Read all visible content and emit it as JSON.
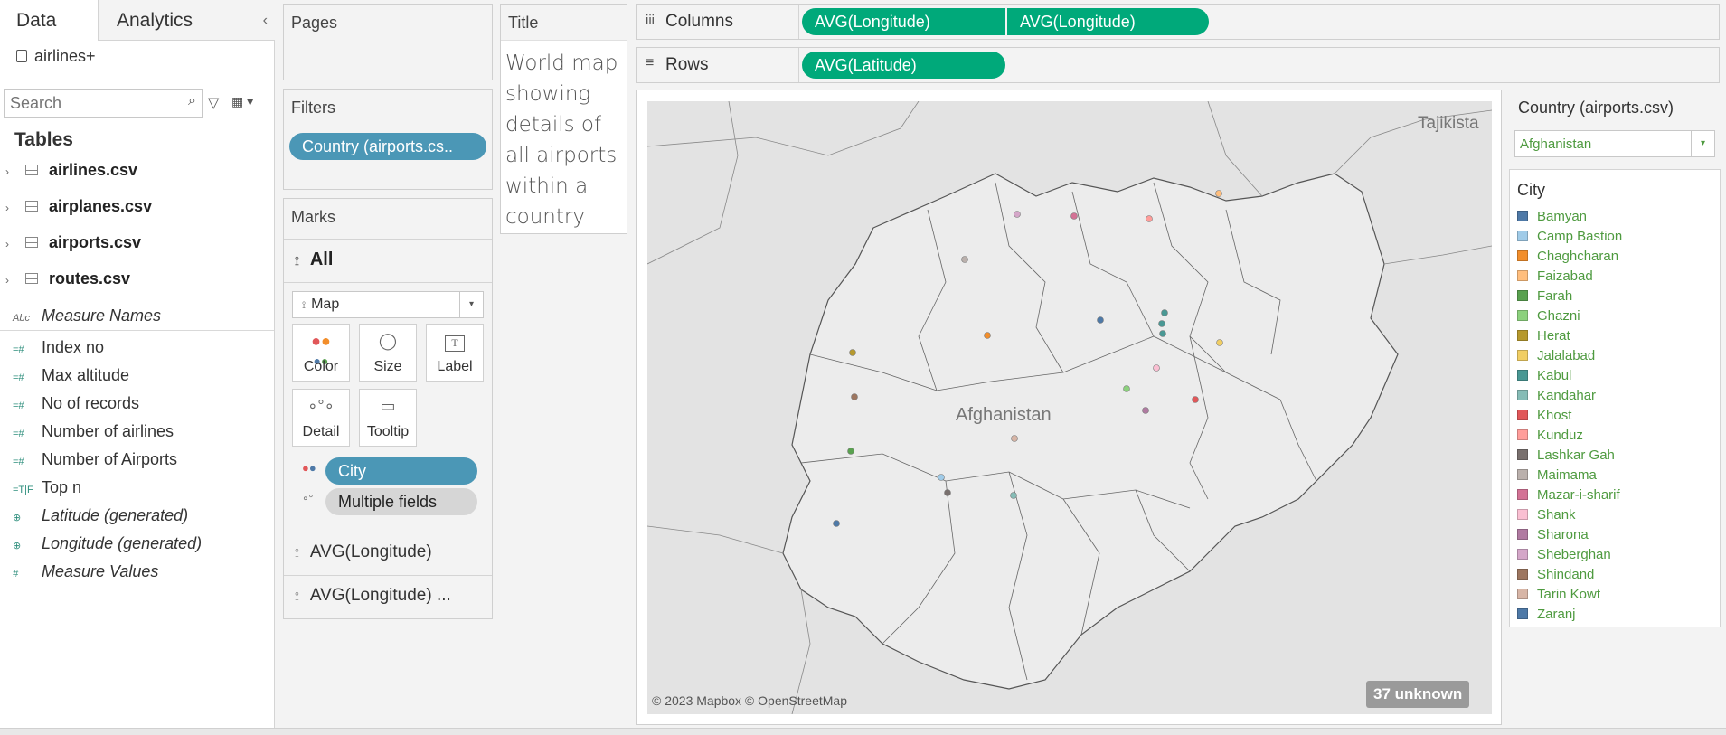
{
  "left_pane": {
    "tabs": [
      "Data",
      "Analytics"
    ],
    "datasource": "airlines+",
    "search_placeholder": "Search",
    "tables_heading": "Tables",
    "tables": [
      "airlines.csv",
      "airplanes.csv",
      "airports.csv",
      "routes.csv"
    ],
    "measure_names": "Measure Names",
    "fields": [
      {
        "name": "Index no",
        "italic": false,
        "icon": "#"
      },
      {
        "name": "Max altitude",
        "italic": false,
        "icon": "#"
      },
      {
        "name": "No of records",
        "italic": false,
        "icon": "#"
      },
      {
        "name": "Number of airlines",
        "italic": false,
        "icon": "#"
      },
      {
        "name": "Number of Airports",
        "italic": false,
        "icon": "#"
      },
      {
        "name": "Top n",
        "italic": false,
        "icon": "#"
      },
      {
        "name": "Latitude (generated)",
        "italic": true,
        "icon": "globe"
      },
      {
        "name": "Longitude (generated)",
        "italic": true,
        "icon": "globe"
      },
      {
        "name": "Measure Values",
        "italic": true,
        "icon": "#"
      }
    ]
  },
  "pages": {
    "title": "Pages"
  },
  "filters": {
    "title": "Filters",
    "pill": "Country (airports.cs.."
  },
  "marks": {
    "title": "Marks",
    "all_label": "All",
    "type": "Map",
    "cards": [
      "Color",
      "Size",
      "Label",
      "Detail",
      "Tooltip"
    ],
    "city_pill": "City",
    "fields_pill": "Multiple fields",
    "layers": [
      "AVG(Longitude)",
      "AVG(Longitude) ..."
    ]
  },
  "title_card": {
    "label": "Title",
    "text": "World map showing details of all airports within a country"
  },
  "columns": {
    "label": "Columns",
    "pills": [
      "AVG(Longitude)",
      "AVG(Longitude)"
    ]
  },
  "rows": {
    "label": "Rows",
    "pills": [
      "AVG(Latitude)"
    ]
  },
  "map": {
    "country_label": "Afghanistan",
    "neighbor_label": "Tajikista",
    "attribution": "© 2023 Mapbox © OpenStreetMap",
    "unknown_badge": "37 unknown"
  },
  "country_filter": {
    "title": "Country (airports.csv)",
    "value": "Afghanistan"
  },
  "legend": {
    "title": "City",
    "items": [
      {
        "name": "Bamyan",
        "color": "#4e79a7"
      },
      {
        "name": "Camp Bastion",
        "color": "#a0cbe8"
      },
      {
        "name": "Chaghcharan",
        "color": "#f28e2b"
      },
      {
        "name": "Faizabad",
        "color": "#ffbe7d"
      },
      {
        "name": "Farah",
        "color": "#59a14f"
      },
      {
        "name": "Ghazni",
        "color": "#8cd17d"
      },
      {
        "name": "Herat",
        "color": "#b6992d"
      },
      {
        "name": "Jalalabad",
        "color": "#f1ce63"
      },
      {
        "name": "Kabul",
        "color": "#499894"
      },
      {
        "name": "Kandahar",
        "color": "#86bcb6"
      },
      {
        "name": "Khost",
        "color": "#e15759"
      },
      {
        "name": "Kunduz",
        "color": "#ff9d9a"
      },
      {
        "name": "Lashkar Gah",
        "color": "#79706e"
      },
      {
        "name": "Maimama",
        "color": "#bab0ac"
      },
      {
        "name": "Mazar-i-sharif",
        "color": "#d37295"
      },
      {
        "name": "Shank",
        "color": "#fabfd2"
      },
      {
        "name": "Sharona",
        "color": "#b07aa1"
      },
      {
        "name": "Sheberghan",
        "color": "#d4a6c8"
      },
      {
        "name": "Shindand",
        "color": "#9d7660"
      },
      {
        "name": "Tarin Kowt",
        "color": "#d7b5a6"
      },
      {
        "name": "Zaranj",
        "color": "#4e79a7"
      }
    ]
  }
}
